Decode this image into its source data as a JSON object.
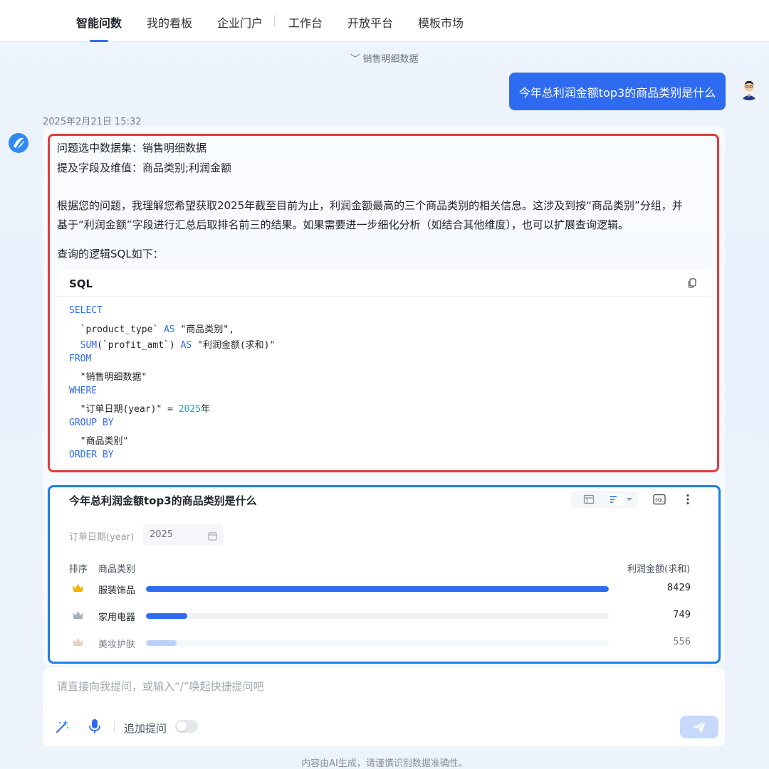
{
  "nav": {
    "items": [
      {
        "label": "智能问数",
        "active": true
      },
      {
        "label": "我的看板"
      },
      {
        "label": "企业门户"
      },
      {
        "label": "工作台"
      },
      {
        "label": "开放平台"
      },
      {
        "label": "模板市场"
      }
    ]
  },
  "dataset_tag": "﹀ 销售明细数据",
  "user_message": "今年总利润金额top3的商品类别是什么",
  "timestamp": "2025年2月21日 15:32",
  "answer": {
    "dataset_line": "问题选中数据集：销售明细数据",
    "fields_line": "提及字段及维值：商品类别;利润金额",
    "explain_line1": "根据您的问题，我理解您希望获取2025年截至目前为止，利润金额最高的三个商品类别的相关信息。这涉及到按“商品类别”分组，并",
    "explain_line2": "基于“利润金额”字段进行汇总后取排名前三的结果。如果需要进一步细化分析（如结合其他维度），也可以扩展查询逻辑。",
    "sql_intro": "查询的逻辑SQL如下：",
    "sql_title": "SQL",
    "sql_lines": [
      {
        "kw": "SELECT"
      },
      {
        "pre": "  `product_type` ",
        "kw": "AS",
        "post": " \"商品类别\","
      },
      {
        "pre": "  ",
        "kw": "SUM",
        "post": "(`profit_amt`) ",
        "kw2": "AS",
        "post2": " \"利润金额(求和)\""
      },
      {
        "kw": "FROM"
      },
      {
        "pre": "  \"销售明细数据\""
      },
      {
        "kw": "WHERE"
      },
      {
        "pre": "  \"订单日期(year)\" = ",
        "num": "2025",
        "post": "年"
      },
      {
        "kw": "GROUP BY"
      },
      {
        "pre": "  \"商品类别\""
      },
      {
        "kw": "ORDER BY"
      }
    ]
  },
  "result": {
    "title": "今年总利润金额top3的商品类别是什么",
    "filter_label": "订单日期(year)",
    "filter_value": "2025",
    "col_rank": "排序",
    "col_category": "商品类别",
    "col_value": "利润金额(求和)",
    "rows": [
      {
        "label": "服装饰品",
        "value": "8429",
        "share": 1.0,
        "bar_color": "#2f6bf0",
        "crown_color": "#f5b400"
      },
      {
        "label": "家用电器",
        "value": "749",
        "share": 0.0889,
        "bar_color": "#2f6bf0",
        "crown_color": "#a8b0bd"
      },
      {
        "label": "美妆护肤",
        "value": "556",
        "share": 0.066,
        "bar_color": "#8fb2f5",
        "crown_color": "#d8b595"
      }
    ]
  },
  "input": {
    "placeholder": "请直接向我提问，或输入“/”唤起快捷提问吧",
    "followup_label": "追加提问"
  },
  "disclaimer": "内容由AI生成，请谨慎识别数据准确性。",
  "colors": {
    "accent": "#2f6bf0",
    "annotation_red": "#e13b3b",
    "annotation_blue": "#1e7ee6"
  }
}
